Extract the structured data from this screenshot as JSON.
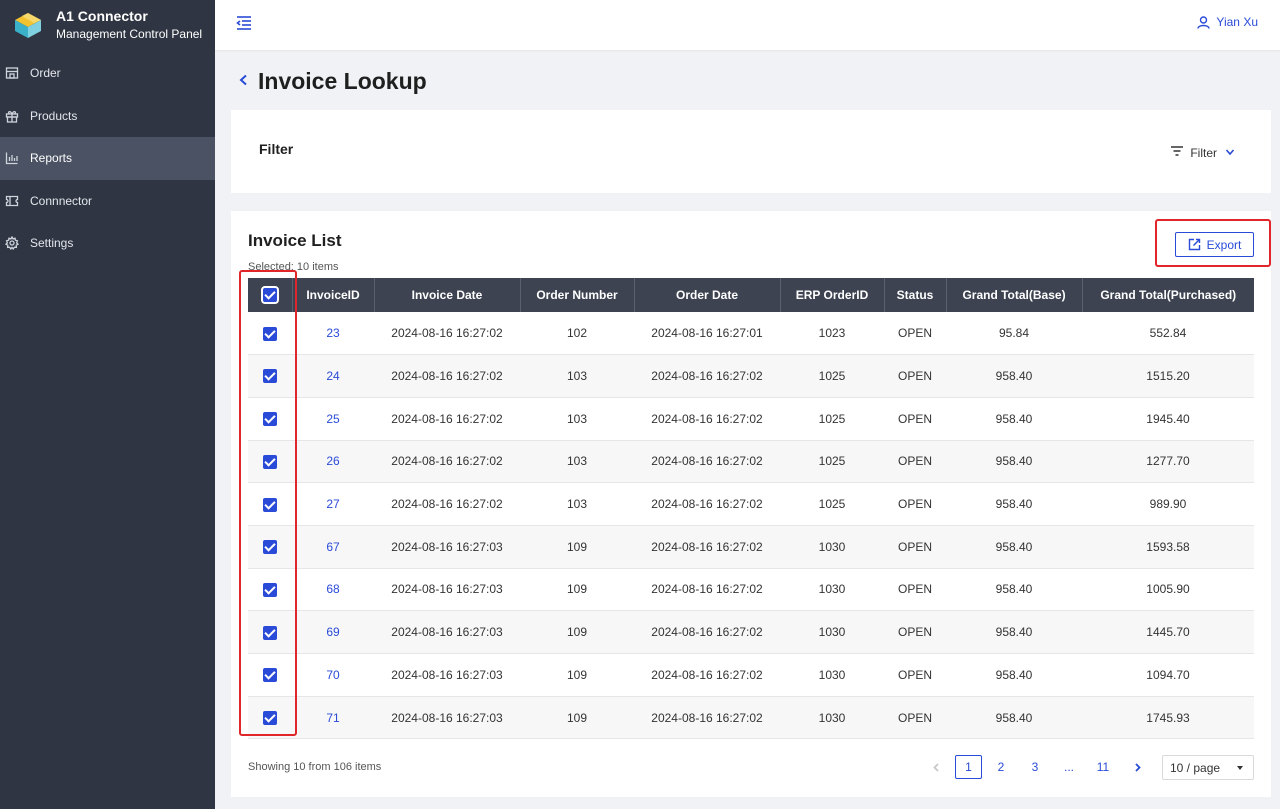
{
  "brand": {
    "name": "A1 Connector",
    "subtitle": "Management Control Panel"
  },
  "sidebar": {
    "items": [
      {
        "label": "Order",
        "icon": "store-icon",
        "active": false
      },
      {
        "label": "Products",
        "icon": "gift-icon",
        "active": false
      },
      {
        "label": "Reports",
        "icon": "bar-chart-icon",
        "active": true
      },
      {
        "label": "Connnector",
        "icon": "ticket-icon",
        "active": false
      },
      {
        "label": "Settings",
        "icon": "gear-icon",
        "active": false
      }
    ]
  },
  "header": {
    "user_name": "Yian Xu"
  },
  "page": {
    "title": "Invoice Lookup"
  },
  "filter": {
    "title": "Filter",
    "button_label": "Filter"
  },
  "list": {
    "title": "Invoice List",
    "selected_info": "Selected: 10 items",
    "export_label": "Export",
    "columns": [
      "InvoiceID",
      "Invoice Date",
      "Order Number",
      "Order Date",
      "ERP OrderID",
      "Status",
      "Grand Total(Base)",
      "Grand Total(Purchased)"
    ],
    "rows": [
      {
        "id": "23",
        "invoice_date": "2024-08-16 16:27:02",
        "order_number": "102",
        "order_date": "2024-08-16 16:27:01",
        "erp_order_id": "1023",
        "status": "OPEN",
        "total_base": "95.84",
        "total_purchased": "552.84",
        "checked": true
      },
      {
        "id": "24",
        "invoice_date": "2024-08-16 16:27:02",
        "order_number": "103",
        "order_date": "2024-08-16 16:27:02",
        "erp_order_id": "1025",
        "status": "OPEN",
        "total_base": "958.40",
        "total_purchased": "1515.20",
        "checked": true
      },
      {
        "id": "25",
        "invoice_date": "2024-08-16 16:27:02",
        "order_number": "103",
        "order_date": "2024-08-16 16:27:02",
        "erp_order_id": "1025",
        "status": "OPEN",
        "total_base": "958.40",
        "total_purchased": "1945.40",
        "checked": true
      },
      {
        "id": "26",
        "invoice_date": "2024-08-16 16:27:02",
        "order_number": "103",
        "order_date": "2024-08-16 16:27:02",
        "erp_order_id": "1025",
        "status": "OPEN",
        "total_base": "958.40",
        "total_purchased": "1277.70",
        "checked": true
      },
      {
        "id": "27",
        "invoice_date": "2024-08-16 16:27:02",
        "order_number": "103",
        "order_date": "2024-08-16 16:27:02",
        "erp_order_id": "1025",
        "status": "OPEN",
        "total_base": "958.40",
        "total_purchased": "989.90",
        "checked": true
      },
      {
        "id": "67",
        "invoice_date": "2024-08-16 16:27:03",
        "order_number": "109",
        "order_date": "2024-08-16 16:27:02",
        "erp_order_id": "1030",
        "status": "OPEN",
        "total_base": "958.40",
        "total_purchased": "1593.58",
        "checked": true
      },
      {
        "id": "68",
        "invoice_date": "2024-08-16 16:27:03",
        "order_number": "109",
        "order_date": "2024-08-16 16:27:02",
        "erp_order_id": "1030",
        "status": "OPEN",
        "total_base": "958.40",
        "total_purchased": "1005.90",
        "checked": true
      },
      {
        "id": "69",
        "invoice_date": "2024-08-16 16:27:03",
        "order_number": "109",
        "order_date": "2024-08-16 16:27:02",
        "erp_order_id": "1030",
        "status": "OPEN",
        "total_base": "958.40",
        "total_purchased": "1445.70",
        "checked": true
      },
      {
        "id": "70",
        "invoice_date": "2024-08-16 16:27:03",
        "order_number": "109",
        "order_date": "2024-08-16 16:27:02",
        "erp_order_id": "1030",
        "status": "OPEN",
        "total_base": "958.40",
        "total_purchased": "1094.70",
        "checked": true
      },
      {
        "id": "71",
        "invoice_date": "2024-08-16 16:27:03",
        "order_number": "109",
        "order_date": "2024-08-16 16:27:02",
        "erp_order_id": "1030",
        "status": "OPEN",
        "total_base": "958.40",
        "total_purchased": "1745.93",
        "checked": true
      }
    ],
    "footer": {
      "showing": "Showing 10 from 106 items",
      "pages": [
        "1",
        "2",
        "3",
        "...",
        "11"
      ],
      "current_page": "1",
      "page_size": "10 / page"
    }
  },
  "colors": {
    "sidebar_bg": "#2f3542",
    "accent": "#2a4bd7",
    "table_header_bg": "#3d4351",
    "highlight": "#e0262a"
  }
}
